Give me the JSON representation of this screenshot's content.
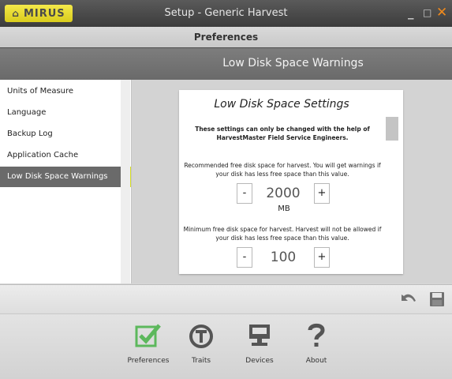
{
  "window": {
    "logo_text": "MIRUS",
    "title": "Setup - Generic Harvest",
    "minimize_glyph": "_",
    "maximize_glyph": "□",
    "close_glyph": "✕",
    "accent_color": "#d7df23",
    "close_color": "#f08a1c"
  },
  "header": {
    "title": "Preferences",
    "section_title": "Low Disk Space Warnings"
  },
  "sidebar": {
    "items": [
      {
        "label": "Units of Measure"
      },
      {
        "label": "Language"
      },
      {
        "label": "Backup Log"
      },
      {
        "label": "Application Cache"
      },
      {
        "label": "Low Disk Space Warnings",
        "active": true
      }
    ]
  },
  "panel": {
    "title": "Low Disk Space Settings",
    "note": "These settings can only be changed with the help of HarvestMaster Field Service Engineers.",
    "recommended": {
      "description": "Recommended free disk space for harvest. You will get warnings if your disk has less free space than this value.",
      "value": "2000",
      "unit": "MB"
    },
    "minimum": {
      "description": "Minimum free disk space for harvest. Harvest will not be allowed if your disk has less free space than this value.",
      "value": "100"
    },
    "decrement_label": "-",
    "increment_label": "+"
  },
  "action_bar": {
    "icons": [
      "undo-icon",
      "save-icon"
    ]
  },
  "bottom_nav": {
    "items": [
      {
        "label": "Preferences",
        "icon": "checkbox-icon",
        "color": "#5cb85c"
      },
      {
        "label": "Traits",
        "icon": "traits-icon"
      },
      {
        "label": "Devices",
        "icon": "monitor-icon"
      },
      {
        "label": "About",
        "icon": "question-icon"
      }
    ]
  }
}
